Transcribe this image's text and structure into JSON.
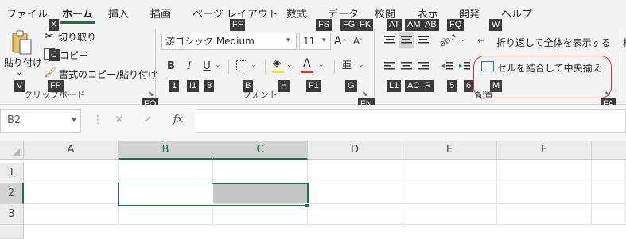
{
  "menu": {
    "tabs": [
      "ファイル",
      "ホーム",
      "挿入",
      "描画",
      "ページ レイアウト",
      "数式",
      "データ",
      "校閲",
      "表示",
      "開発",
      "ヘルプ"
    ],
    "active": "ホーム"
  },
  "ribbon": {
    "clipboard": {
      "paste_label": "貼り付け",
      "cut_label": "切り取り",
      "copy_label": "コピー",
      "copy_arrow": "⌄",
      "format_painter_label": "書式のコピー/貼り付け",
      "group_label": "クリップボード",
      "paste_arrow": "⌄"
    },
    "font": {
      "family": "游ゴシック Medium",
      "size": "11",
      "group_label": "フォント",
      "bold": "B",
      "italic": "I",
      "underline": "U",
      "font_color_letter": "A",
      "grow": "A",
      "shrink": "A",
      "phonetic": "亜",
      "colors": {
        "highlight": "#f5e12a",
        "font_color": "#e03030"
      }
    },
    "alignment": {
      "wrap_label": "折り返して全体を表示する",
      "merge_label": "セルを結合して中央揃え",
      "group_label": "配置"
    },
    "extra_char": "標"
  },
  "keytips": {
    "X": "X",
    "C": "C",
    "FP": "FP",
    "V": "V",
    "FO": "FO",
    "FF": "FF",
    "FS": "FS",
    "FG": "FG",
    "FK": "FK",
    "B": "B",
    "I": "I",
    "U": "3",
    "I1": "I1",
    "B2": "B",
    "H": "H",
    "F1": "F1",
    "G": "G",
    "FN": "FN",
    "AT": "AT",
    "AM": "AM",
    "AB": "AB",
    "FQ": "FQ",
    "W": "W",
    "L1": "L1",
    "AC": "AC",
    "R": "R",
    "n5": "5",
    "n6": "6",
    "M": "M",
    "FA": "FA",
    "n1": "1"
  },
  "formula_bar": {
    "name_box": "B2",
    "cancel": "✕",
    "enter": "✓",
    "fx": "fx",
    "value": ""
  },
  "sheet": {
    "columns": [
      "A",
      "B",
      "C",
      "D",
      "E",
      "F"
    ],
    "rows": [
      "1",
      "2",
      "3"
    ],
    "selected_range": "B2:C2"
  }
}
